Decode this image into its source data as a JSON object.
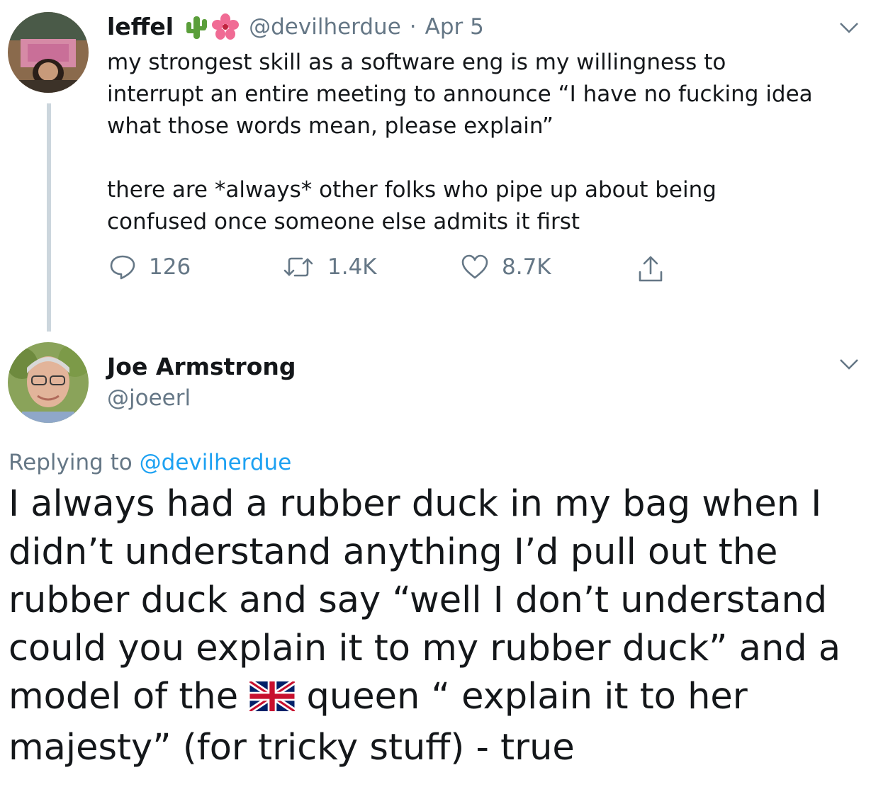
{
  "tweet1": {
    "name": "leffel",
    "handle": "@devilherdue",
    "separator": "·",
    "date": "Apr 5",
    "text_para1": "my strongest skill as a software eng is my willingness to\ninterrupt an entire meeting to announce “I have no fucking idea\nwhat those words mean, please explain”",
    "text_para2": "there are *always* other folks who pipe up about being\nconfused once someone else admits it first",
    "replies": "126",
    "retweets": "1.4K",
    "likes": "8.7K"
  },
  "tweet2": {
    "name": "Joe Armstrong",
    "handle": "@joeerl",
    "replying_prefix": "Replying to",
    "replying_handle": "@devilherdue",
    "text_before_flag": "I always had a rubber duck in my bag when I\ndidn’t understand anything I’d pull out the\nrubber duck and say “well I don’t understand\ncould you explain it to my rubber duck” and a\nmodel of the",
    "text_after_flag": "queen “ explain it to her\nmajesty” (for tricky stuff) - true"
  },
  "icons": {
    "emoji1": "cactus-icon",
    "emoji2": "hibiscus-icon",
    "flag": "uk-flag-icon"
  },
  "colors": {
    "link": "#1da1f2",
    "muted": "#657786",
    "text": "#14171a",
    "thread_line": "#ccd6dd"
  }
}
